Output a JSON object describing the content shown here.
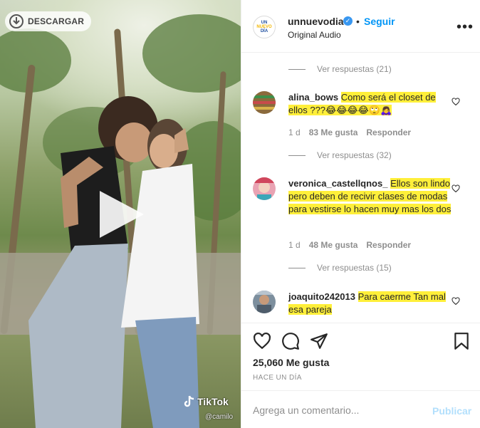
{
  "media": {
    "download_label": "DESCARGAR",
    "watermark": "TikTok",
    "watermark_handle": "@camilo"
  },
  "post": {
    "username": "unnuevodia",
    "logo_lines": [
      "UN",
      "NUEVO",
      "DÍA"
    ],
    "verified_mark": "✓",
    "separator": "•",
    "follow_label": "Seguir",
    "audio_label": "Original Audio",
    "more_label": "•••"
  },
  "comments": [
    {
      "replies_before": "Ver respuestas (21)"
    },
    {
      "username": "alina_bows",
      "text": "Como será el closet de ellos ???😂😂😂😂🙄🙇‍♀️",
      "time": "1 d",
      "likes": "83 Me gusta",
      "reply": "Responder",
      "replies_after": "Ver respuestas (32)"
    },
    {
      "username": "veronica_castellqnos_",
      "text": "Ellos son lindo pero deben de recivir clases de modas para vestirse lo hacen muy mas los dos",
      "time": "1 d",
      "likes": "48 Me gusta",
      "reply": "Responder",
      "replies_after": "Ver respuestas (15)"
    },
    {
      "username": "joaquito242013",
      "text": "Para caerme Tan mal esa pareja"
    }
  ],
  "footer": {
    "likes": "25,060 Me gusta",
    "date": "HACE UN DÍA",
    "comment_placeholder": "Agrega un comentario...",
    "publish_label": "Publicar"
  },
  "colors": {
    "accent": "#0095f6",
    "highlight": "#ffef3a",
    "verified": "#3897f0"
  }
}
